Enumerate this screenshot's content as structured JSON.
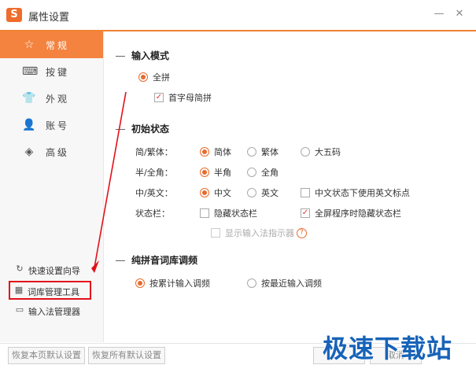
{
  "window": {
    "title": "属性设置",
    "logo": "S"
  },
  "titlebar": {
    "minimize": "—",
    "close": "✕"
  },
  "sidebar": {
    "items": [
      {
        "label": "常规",
        "icon": "☆",
        "icon_name": "star-icon",
        "active": true
      },
      {
        "label": "按键",
        "icon": "⌨",
        "icon_name": "keyboard-icon"
      },
      {
        "label": "外观",
        "icon": "👕",
        "icon_name": "shirt-icon"
      },
      {
        "label": "账号",
        "icon": "👤",
        "icon_name": "person-icon"
      },
      {
        "label": "高级",
        "icon": "◈",
        "icon_name": "layers-icon"
      }
    ],
    "tools": [
      {
        "label": "快速设置向导",
        "icon": "↻",
        "icon_name": "refresh-icon"
      },
      {
        "label": "词库管理工具",
        "icon": "▦",
        "icon_name": "grid-icon",
        "highlighted": true
      },
      {
        "label": "输入法管理器",
        "icon": "▭",
        "icon_name": "monitor-icon"
      }
    ]
  },
  "sections": {
    "input_mode": {
      "title": "输入模式",
      "full_pinyin": "全拼",
      "initial_jianpin": "首字母简拼"
    },
    "initial_state": {
      "title": "初始状态",
      "rows": {
        "charset": {
          "label": "简/繁体：",
          "opts": [
            "简体",
            "繁体",
            "大五码"
          ]
        },
        "width": {
          "label": "半/全角：",
          "opts": [
            "半角",
            "全角"
          ]
        },
        "lang": {
          "label": "中/英文：",
          "opts": [
            "中文",
            "英文"
          ],
          "extra": "中文状态下使用英文标点"
        },
        "statusbar": {
          "label": "状态栏：",
          "hide": "隐藏状态栏",
          "fullscreen_hide": "全屏程序时隐藏状态栏",
          "show_indicator": "显示输入法指示器"
        }
      }
    },
    "pure_pinyin": {
      "title": "纯拼音词库调频",
      "cumulative": "按累计输入调频",
      "recent": "按最近输入调频"
    }
  },
  "footer": {
    "restore_page": "恢复本页默认设置",
    "restore_all": "恢复所有默认设置",
    "cancel": "取消"
  },
  "watermark": "极速下载站",
  "colors": {
    "accent": "#f4833f",
    "highlight_box": "#e3101a",
    "watermark": "#1763b8"
  }
}
